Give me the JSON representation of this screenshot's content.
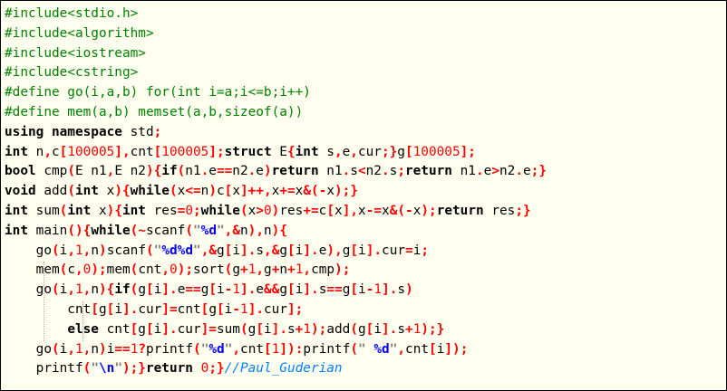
{
  "colors": {
    "background": "#fffff0",
    "preprocessor": "#008000",
    "keyword": "#000000",
    "operator": "#ff0000",
    "number": "#ff0000",
    "string": "#808080",
    "format_specifier": "#0000ff",
    "comment": "#0080ff"
  },
  "code_lines": [
    [
      [
        "pre",
        "#include<stdio.h>"
      ]
    ],
    [
      [
        "pre",
        "#include<algorithm>"
      ]
    ],
    [
      [
        "pre",
        "#include<iostream>"
      ]
    ],
    [
      [
        "pre",
        "#include<cstring>"
      ]
    ],
    [
      [
        "pre",
        "#define go(i,a,b) for(int i=a;i<=b;i++)"
      ]
    ],
    [
      [
        "pre",
        "#define mem(a,b) memset(a,b,sizeof(a))"
      ]
    ],
    [
      [
        "kw",
        "using namespace"
      ],
      [
        "id",
        " std"
      ],
      [
        "op",
        ";"
      ]
    ],
    [
      [
        "kw",
        "int"
      ],
      [
        "id",
        " n"
      ],
      [
        "op",
        ","
      ],
      [
        "id",
        "c"
      ],
      [
        "op",
        "["
      ],
      [
        "num",
        "100005"
      ],
      [
        "op",
        "],"
      ],
      [
        "id",
        "cnt"
      ],
      [
        "op",
        "["
      ],
      [
        "num",
        "100005"
      ],
      [
        "op",
        "];"
      ],
      [
        "kw",
        "struct"
      ],
      [
        "id",
        " E"
      ],
      [
        "op",
        "{"
      ],
      [
        "kw",
        "int"
      ],
      [
        "id",
        " s"
      ],
      [
        "op",
        ","
      ],
      [
        "id",
        "e"
      ],
      [
        "op",
        ","
      ],
      [
        "id",
        "cur"
      ],
      [
        "op",
        ";}"
      ],
      [
        "id",
        "g"
      ],
      [
        "op",
        "["
      ],
      [
        "num",
        "100005"
      ],
      [
        "op",
        "];"
      ]
    ],
    [
      [
        "kw",
        "bool"
      ],
      [
        "id",
        " cmp"
      ],
      [
        "op",
        "("
      ],
      [
        "id",
        "E n1"
      ],
      [
        "op",
        ","
      ],
      [
        "id",
        "E n2"
      ],
      [
        "op",
        "){"
      ],
      [
        "kw",
        "if"
      ],
      [
        "op",
        "("
      ],
      [
        "id",
        "n1"
      ],
      [
        "op",
        "."
      ],
      [
        "id",
        "e"
      ],
      [
        "op",
        "=="
      ],
      [
        "id",
        "n2"
      ],
      [
        "op",
        "."
      ],
      [
        "id",
        "e"
      ],
      [
        "op",
        ")"
      ],
      [
        "kw",
        "return"
      ],
      [
        "id",
        " n1"
      ],
      [
        "op",
        "."
      ],
      [
        "id",
        "s"
      ],
      [
        "op",
        "<"
      ],
      [
        "id",
        "n2"
      ],
      [
        "op",
        "."
      ],
      [
        "id",
        "s"
      ],
      [
        "op",
        ";"
      ],
      [
        "kw",
        "return"
      ],
      [
        "id",
        " n1"
      ],
      [
        "op",
        "."
      ],
      [
        "id",
        "e"
      ],
      [
        "op",
        ">"
      ],
      [
        "id",
        "n2"
      ],
      [
        "op",
        "."
      ],
      [
        "id",
        "e"
      ],
      [
        "op",
        ";}"
      ]
    ],
    [
      [
        "kw",
        "void"
      ],
      [
        "id",
        " add"
      ],
      [
        "op",
        "("
      ],
      [
        "kw",
        "int"
      ],
      [
        "id",
        " x"
      ],
      [
        "op",
        "){"
      ],
      [
        "kw",
        "while"
      ],
      [
        "op",
        "("
      ],
      [
        "id",
        "x"
      ],
      [
        "op",
        "<="
      ],
      [
        "id",
        "n"
      ],
      [
        "op",
        ")"
      ],
      [
        "id",
        "c"
      ],
      [
        "op",
        "["
      ],
      [
        "id",
        "x"
      ],
      [
        "op",
        "]++,"
      ],
      [
        "id",
        "x"
      ],
      [
        "op",
        "+="
      ],
      [
        "id",
        "x"
      ],
      [
        "op",
        "&(-"
      ],
      [
        "id",
        "x"
      ],
      [
        "op",
        ");}"
      ]
    ],
    [
      [
        "kw",
        "int"
      ],
      [
        "id",
        " sum"
      ],
      [
        "op",
        "("
      ],
      [
        "kw",
        "int"
      ],
      [
        "id",
        " x"
      ],
      [
        "op",
        "){"
      ],
      [
        "kw",
        "int"
      ],
      [
        "id",
        " res"
      ],
      [
        "op",
        "="
      ],
      [
        "num",
        "0"
      ],
      [
        "op",
        ";"
      ],
      [
        "kw",
        "while"
      ],
      [
        "op",
        "("
      ],
      [
        "id",
        "x"
      ],
      [
        "op",
        ">"
      ],
      [
        "num",
        "0"
      ],
      [
        "op",
        ")"
      ],
      [
        "id",
        "res"
      ],
      [
        "op",
        "+="
      ],
      [
        "id",
        "c"
      ],
      [
        "op",
        "["
      ],
      [
        "id",
        "x"
      ],
      [
        "op",
        "],"
      ],
      [
        "id",
        "x"
      ],
      [
        "op",
        "-="
      ],
      [
        "id",
        "x"
      ],
      [
        "op",
        "&(-"
      ],
      [
        "id",
        "x"
      ],
      [
        "op",
        ");"
      ],
      [
        "kw",
        "return"
      ],
      [
        "id",
        " res"
      ],
      [
        "op",
        ";}"
      ]
    ],
    [
      [
        "kw",
        "int"
      ],
      [
        "id",
        " main"
      ],
      [
        "op",
        "(){"
      ],
      [
        "kw",
        "while"
      ],
      [
        "op",
        "(~"
      ],
      [
        "id",
        "scanf"
      ],
      [
        "op",
        "("
      ],
      [
        "str",
        "\""
      ],
      [
        "fmt",
        "%d"
      ],
      [
        "str",
        "\""
      ],
      [
        "op",
        ",&"
      ],
      [
        "id",
        "n"
      ],
      [
        "op",
        "),"
      ],
      [
        "id",
        "n"
      ],
      [
        "op",
        "){"
      ]
    ],
    [
      [
        "id",
        "    go"
      ],
      [
        "op",
        "("
      ],
      [
        "id",
        "i"
      ],
      [
        "op",
        ","
      ],
      [
        "num",
        "1"
      ],
      [
        "op",
        ","
      ],
      [
        "id",
        "n"
      ],
      [
        "op",
        ")"
      ],
      [
        "id",
        "scanf"
      ],
      [
        "op",
        "("
      ],
      [
        "str",
        "\""
      ],
      [
        "fmt",
        "%d%d"
      ],
      [
        "str",
        "\""
      ],
      [
        "op",
        ",&"
      ],
      [
        "id",
        "g"
      ],
      [
        "op",
        "["
      ],
      [
        "id",
        "i"
      ],
      [
        "op",
        "]."
      ],
      [
        "id",
        "s"
      ],
      [
        "op",
        ",&"
      ],
      [
        "id",
        "g"
      ],
      [
        "op",
        "["
      ],
      [
        "id",
        "i"
      ],
      [
        "op",
        "]."
      ],
      [
        "id",
        "e"
      ],
      [
        "op",
        "),"
      ],
      [
        "id",
        "g"
      ],
      [
        "op",
        "["
      ],
      [
        "id",
        "i"
      ],
      [
        "op",
        "]."
      ],
      [
        "id",
        "cur"
      ],
      [
        "op",
        "="
      ],
      [
        "id",
        "i"
      ],
      [
        "op",
        ";"
      ]
    ],
    [
      [
        "id",
        "    mem"
      ],
      [
        "op",
        "("
      ],
      [
        "id",
        "c"
      ],
      [
        "op",
        ","
      ],
      [
        "num",
        "0"
      ],
      [
        "op",
        ");"
      ],
      [
        "id",
        "mem"
      ],
      [
        "op",
        "("
      ],
      [
        "id",
        "cnt"
      ],
      [
        "op",
        ","
      ],
      [
        "num",
        "0"
      ],
      [
        "op",
        ");"
      ],
      [
        "id",
        "sort"
      ],
      [
        "op",
        "("
      ],
      [
        "id",
        "g"
      ],
      [
        "op",
        "+"
      ],
      [
        "num",
        "1"
      ],
      [
        "op",
        ","
      ],
      [
        "id",
        "g"
      ],
      [
        "op",
        "+"
      ],
      [
        "id",
        "n"
      ],
      [
        "op",
        "+"
      ],
      [
        "num",
        "1"
      ],
      [
        "op",
        ","
      ],
      [
        "id",
        "cmp"
      ],
      [
        "op",
        ");"
      ]
    ],
    [
      [
        "id",
        "    go"
      ],
      [
        "op",
        "("
      ],
      [
        "id",
        "i"
      ],
      [
        "op",
        ","
      ],
      [
        "num",
        "1"
      ],
      [
        "op",
        ","
      ],
      [
        "id",
        "n"
      ],
      [
        "op",
        "){"
      ],
      [
        "kw",
        "if"
      ],
      [
        "op",
        "("
      ],
      [
        "id",
        "g"
      ],
      [
        "op",
        "["
      ],
      [
        "id",
        "i"
      ],
      [
        "op",
        "]."
      ],
      [
        "id",
        "e"
      ],
      [
        "op",
        "=="
      ],
      [
        "id",
        "g"
      ],
      [
        "op",
        "["
      ],
      [
        "id",
        "i"
      ],
      [
        "op",
        "-"
      ],
      [
        "num",
        "1"
      ],
      [
        "op",
        "]."
      ],
      [
        "id",
        "e"
      ],
      [
        "op",
        "&&"
      ],
      [
        "id",
        "g"
      ],
      [
        "op",
        "["
      ],
      [
        "id",
        "i"
      ],
      [
        "op",
        "]."
      ],
      [
        "id",
        "s"
      ],
      [
        "op",
        "=="
      ],
      [
        "id",
        "g"
      ],
      [
        "op",
        "["
      ],
      [
        "id",
        "i"
      ],
      [
        "op",
        "-"
      ],
      [
        "num",
        "1"
      ],
      [
        "op",
        "]."
      ],
      [
        "id",
        "s"
      ],
      [
        "op",
        ")"
      ]
    ],
    [
      [
        "id",
        "        cnt"
      ],
      [
        "op",
        "["
      ],
      [
        "id",
        "g"
      ],
      [
        "op",
        "["
      ],
      [
        "id",
        "i"
      ],
      [
        "op",
        "]."
      ],
      [
        "id",
        "cur"
      ],
      [
        "op",
        "]="
      ],
      [
        "id",
        "cnt"
      ],
      [
        "op",
        "["
      ],
      [
        "id",
        "g"
      ],
      [
        "op",
        "["
      ],
      [
        "id",
        "i"
      ],
      [
        "op",
        "-"
      ],
      [
        "num",
        "1"
      ],
      [
        "op",
        "]."
      ],
      [
        "id",
        "cur"
      ],
      [
        "op",
        "];"
      ]
    ],
    [
      [
        "id",
        "        "
      ],
      [
        "kw",
        "else"
      ],
      [
        "id",
        " cnt"
      ],
      [
        "op",
        "["
      ],
      [
        "id",
        "g"
      ],
      [
        "op",
        "["
      ],
      [
        "id",
        "i"
      ],
      [
        "op",
        "]."
      ],
      [
        "id",
        "cur"
      ],
      [
        "op",
        "]="
      ],
      [
        "id",
        "sum"
      ],
      [
        "op",
        "("
      ],
      [
        "id",
        "g"
      ],
      [
        "op",
        "["
      ],
      [
        "id",
        "i"
      ],
      [
        "op",
        "]."
      ],
      [
        "id",
        "s"
      ],
      [
        "op",
        "+"
      ],
      [
        "num",
        "1"
      ],
      [
        "op",
        ");"
      ],
      [
        "id",
        "add"
      ],
      [
        "op",
        "("
      ],
      [
        "id",
        "g"
      ],
      [
        "op",
        "["
      ],
      [
        "id",
        "i"
      ],
      [
        "op",
        "]."
      ],
      [
        "id",
        "s"
      ],
      [
        "op",
        "+"
      ],
      [
        "num",
        "1"
      ],
      [
        "op",
        ");}"
      ]
    ],
    [
      [
        "id",
        "    go"
      ],
      [
        "op",
        "("
      ],
      [
        "id",
        "i"
      ],
      [
        "op",
        ","
      ],
      [
        "num",
        "1"
      ],
      [
        "op",
        ","
      ],
      [
        "id",
        "n"
      ],
      [
        "op",
        ")"
      ],
      [
        "id",
        "i"
      ],
      [
        "op",
        "=="
      ],
      [
        "num",
        "1"
      ],
      [
        "op",
        "?"
      ],
      [
        "id",
        "printf"
      ],
      [
        "op",
        "("
      ],
      [
        "str",
        "\""
      ],
      [
        "fmt",
        "%d"
      ],
      [
        "str",
        "\""
      ],
      [
        "op",
        ","
      ],
      [
        "id",
        "cnt"
      ],
      [
        "op",
        "["
      ],
      [
        "num",
        "1"
      ],
      [
        "op",
        "]):"
      ],
      [
        "id",
        "printf"
      ],
      [
        "op",
        "("
      ],
      [
        "str",
        "\" "
      ],
      [
        "fmt",
        "%d"
      ],
      [
        "str",
        "\""
      ],
      [
        "op",
        ","
      ],
      [
        "id",
        "cnt"
      ],
      [
        "op",
        "["
      ],
      [
        "id",
        "i"
      ],
      [
        "op",
        "]);"
      ]
    ],
    [
      [
        "id",
        "    printf"
      ],
      [
        "op",
        "("
      ],
      [
        "str",
        "\""
      ],
      [
        "fmt",
        "\\n"
      ],
      [
        "str",
        "\""
      ],
      [
        "op",
        ");}"
      ],
      [
        "kw",
        "return"
      ],
      [
        "id",
        " "
      ],
      [
        "num",
        "0"
      ],
      [
        "op",
        ";}"
      ],
      [
        "cmt",
        "//Paul_Guderian"
      ]
    ]
  ]
}
